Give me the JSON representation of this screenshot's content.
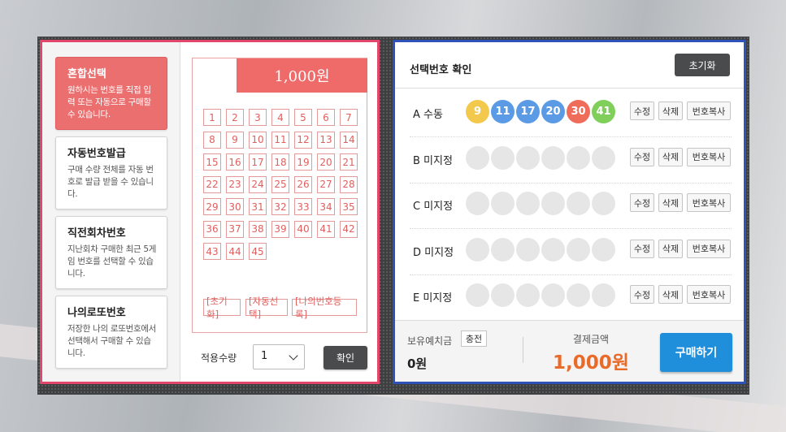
{
  "menu": [
    {
      "title": "혼합선택",
      "desc": "원하시는 번호를 직접 입력 또는 자동으로 구매할 수 있습니다.",
      "active": true
    },
    {
      "title": "자동번호발급",
      "desc": "구매 수량 전체를 자동 번호로 발급 받을 수 있습니다.",
      "active": false
    },
    {
      "title": "직전회차번호",
      "desc": "지난회차 구매한 최근 5게임 번호를 선택할 수 있습니다.",
      "active": false
    },
    {
      "title": "나의로또번호",
      "desc": "저장한 나의 로또번호에서 선택해서 구매할 수 있습니다.",
      "active": false
    }
  ],
  "picker": {
    "price": "1,000원",
    "numbers": [
      "1",
      "2",
      "3",
      "4",
      "5",
      "6",
      "7",
      "8",
      "9",
      "10",
      "11",
      "12",
      "13",
      "14",
      "15",
      "16",
      "17",
      "18",
      "19",
      "20",
      "21",
      "22",
      "23",
      "24",
      "25",
      "26",
      "27",
      "28",
      "29",
      "30",
      "31",
      "32",
      "33",
      "34",
      "35",
      "36",
      "37",
      "38",
      "39",
      "40",
      "41",
      "42",
      "43",
      "44",
      "45"
    ],
    "buttons": [
      "초기화",
      "자동선택",
      "나의번호등록"
    ]
  },
  "quantity": {
    "label": "적용수량",
    "value": "1",
    "confirm": "확인"
  },
  "selection": {
    "title": "선택번호 확인",
    "reset": "초기화",
    "edit": "수정",
    "delete": "삭제",
    "copy": "번호복사",
    "rows": [
      {
        "label": "A 수동",
        "balls": [
          {
            "n": "9",
            "color": "#f2c94c"
          },
          {
            "n": "11",
            "color": "#5b9be6"
          },
          {
            "n": "17",
            "color": "#5b9be6"
          },
          {
            "n": "20",
            "color": "#5b9be6"
          },
          {
            "n": "30",
            "color": "#ef6b5a"
          },
          {
            "n": "41",
            "color": "#7fcf5a"
          }
        ]
      },
      {
        "label": "B 미지정",
        "balls": []
      },
      {
        "label": "C 미지정",
        "balls": []
      },
      {
        "label": "D 미지정",
        "balls": []
      },
      {
        "label": "E 미지정",
        "balls": []
      }
    ]
  },
  "footer": {
    "balance_label": "보유예치금",
    "charge": "충전",
    "balance": "0원",
    "pay_label": "결제금액",
    "pay_value": "1,000원",
    "buy": "구매하기"
  },
  "colors": {
    "left_border": "#e2476b",
    "right_border": "#2e52b8",
    "accent": "#ef6b6a",
    "buy": "#1f8fdc",
    "pay": "#ea6a2a"
  }
}
